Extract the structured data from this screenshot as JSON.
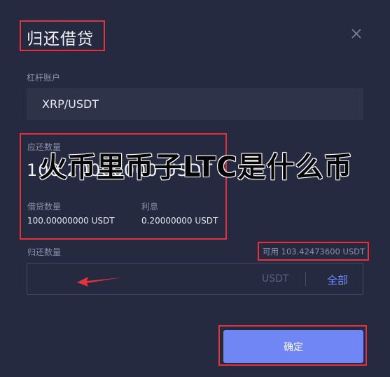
{
  "dialog": {
    "title": "归还借贷",
    "account": {
      "label": "杠杆账户",
      "value": "XRP/USDT"
    },
    "due": {
      "label": "应还数量",
      "value": "100.20000000 USDT",
      "borrowed_label": "借贷数量",
      "borrowed_value": "100.00000000 USDT",
      "interest_label": "利息",
      "interest_value": "0.20000000 USDT"
    },
    "repay": {
      "label": "归还数量",
      "available": "可用 103.42473600 USDT",
      "unit": "USDT",
      "all_label": "全部"
    },
    "confirm_label": "确定"
  },
  "overlay": {
    "text": "火币里币子LTC是什么币"
  },
  "colors": {
    "highlight": "#e3323c",
    "accent": "#6f86f4",
    "link": "#6f8dff",
    "background": "#262a40"
  }
}
